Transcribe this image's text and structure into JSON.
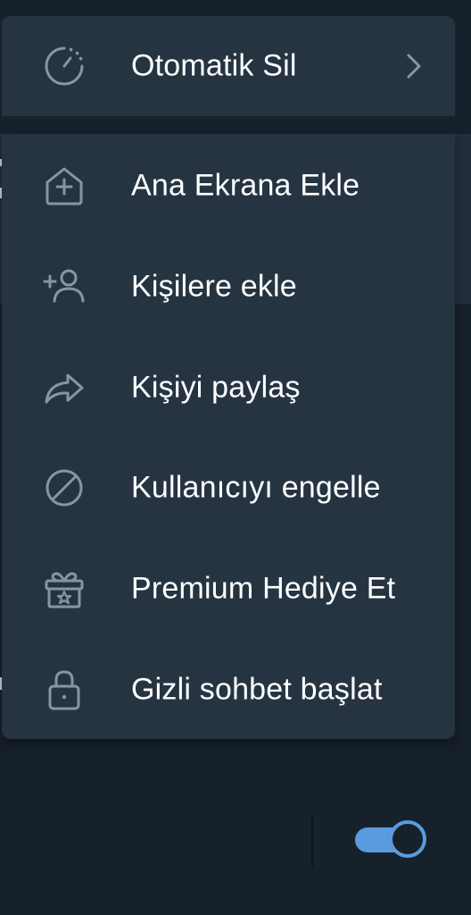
{
  "menu": {
    "top_item": {
      "label": "Otomatik Sil",
      "icon": "timer-icon"
    },
    "items": [
      {
        "label": "Ana Ekrana Ekle",
        "icon": "home-add-icon"
      },
      {
        "label": "Kişilere ekle",
        "icon": "add-contact-icon"
      },
      {
        "label": "Kişiyi paylaş",
        "icon": "share-icon"
      },
      {
        "label": "Kullanıcıyı engelle",
        "icon": "block-icon"
      },
      {
        "label": "Premium Hediye Et",
        "icon": "gift-icon"
      },
      {
        "label": "Gizli sohbet başlat",
        "icon": "lock-icon"
      }
    ]
  },
  "toggle": {
    "state": "on"
  },
  "colors": {
    "background": "#17212b",
    "menu": "#263442",
    "icon": "#8696a6",
    "accent": "#5a9be0"
  }
}
